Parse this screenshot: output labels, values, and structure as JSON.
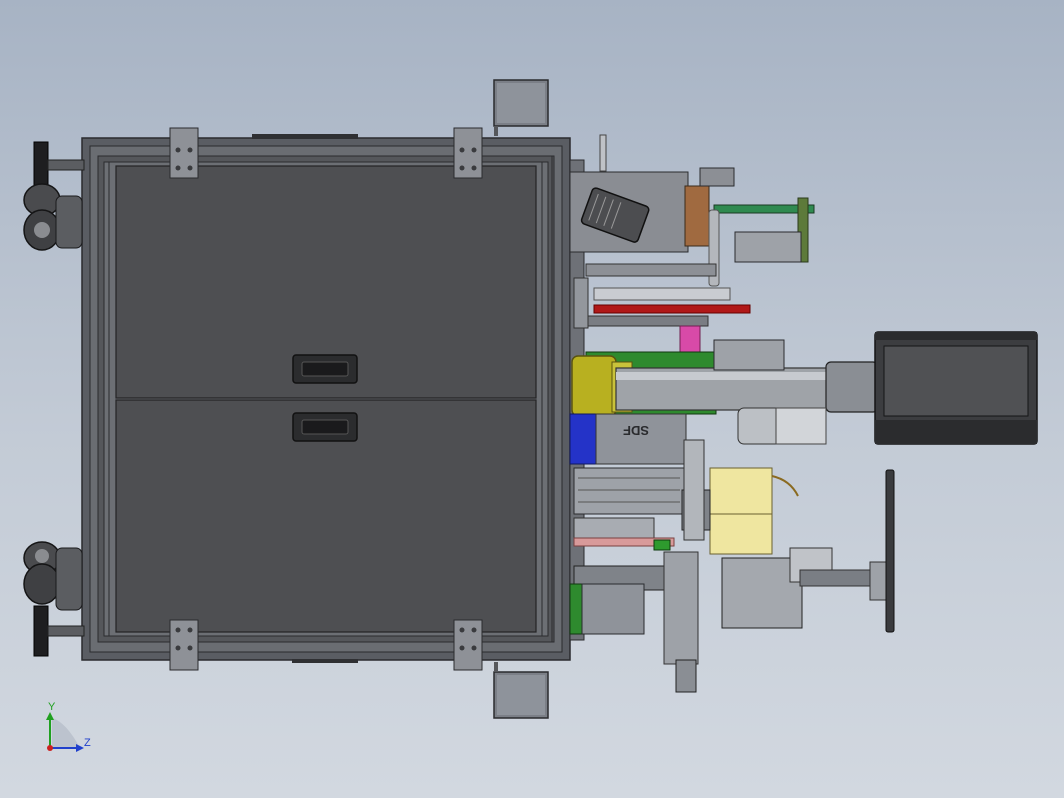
{
  "viewport": {
    "model_marking": "SDF"
  },
  "triad": {
    "y_label": "Y",
    "z_label": "Z"
  },
  "colors": {
    "background_top": "#a7b3c4",
    "background_bottom": "#d2d8e0",
    "frame": "#5a5d63",
    "panel": "#4e4f52",
    "cylinder_yellow": "#b8b020",
    "block_blue": "#2433c8",
    "block_green": "#2e8a2e",
    "rod_red": "#b01818",
    "block_pink": "#d84aa8",
    "block_cream": "#efe6a0",
    "motor_dark": "#3c3d40",
    "triad_x_red": "#cc2020",
    "triad_y_green": "#20a020",
    "triad_z_blue": "#2040cc"
  },
  "icons": [
    "coordinate-triad-icon",
    "caster-wheel-icon",
    "handle-icon",
    "motor-icon",
    "handwheel-icon"
  ]
}
